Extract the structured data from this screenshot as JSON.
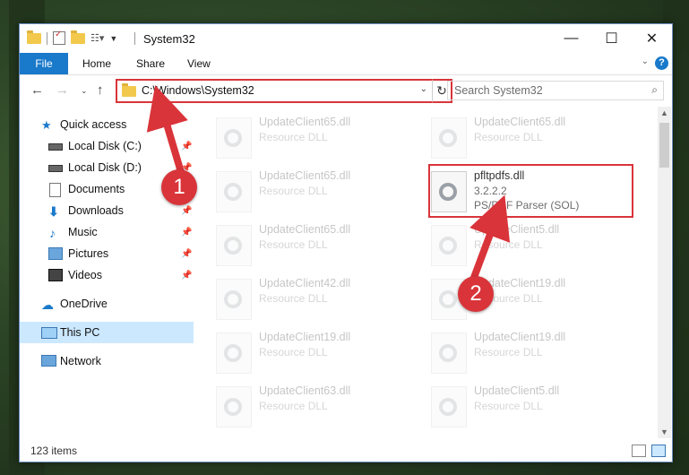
{
  "window": {
    "title": "System32"
  },
  "ribbon": {
    "tabs": [
      "File",
      "Home",
      "Share",
      "View"
    ],
    "help": "?"
  },
  "address": {
    "path": "C:\\Windows\\System32"
  },
  "search": {
    "placeholder": "Search System32"
  },
  "sidebar": {
    "items": [
      {
        "label": "Quick access",
        "icon": "star-icon"
      },
      {
        "label": "Local Disk (C:)",
        "icon": "drive-icon",
        "pinned": true
      },
      {
        "label": "Local Disk (D:)",
        "icon": "drive-icon",
        "pinned": true
      },
      {
        "label": "Documents",
        "icon": "documents-icon",
        "pinned": true
      },
      {
        "label": "Downloads",
        "icon": "download-icon",
        "pinned": true
      },
      {
        "label": "Music",
        "icon": "music-icon",
        "pinned": true
      },
      {
        "label": "Pictures",
        "icon": "pictures-icon",
        "pinned": true
      },
      {
        "label": "Videos",
        "icon": "videos-icon",
        "pinned": true
      },
      {
        "label": "OneDrive",
        "icon": "cloud-icon"
      },
      {
        "label": "This PC",
        "icon": "pc-icon",
        "selected": true
      },
      {
        "label": "Network",
        "icon": "network-icon"
      }
    ]
  },
  "files": [
    {
      "name": "UpdateClient65.dll",
      "type": "Resource DLL"
    },
    {
      "name": "UpdateClient65.dll",
      "type": "Resource DLL"
    },
    {
      "name": "UpdateClient65.dll",
      "type": "Resource DLL"
    },
    {
      "name": "pfltpdfs.dll",
      "version": "3.2.2.2",
      "description": "PS/PDF Parser (SOL)",
      "highlighted": true
    },
    {
      "name": "UpdateClient65.dll",
      "type": "Resource DLL"
    },
    {
      "name": "UpdateClient5.dll",
      "type": "Resource DLL"
    },
    {
      "name": "UpdateClient42.dll",
      "type": "Resource DLL"
    },
    {
      "name": "UpdateClient19.dll",
      "type": "Resource DLL"
    },
    {
      "name": "UpdateClient19.dll",
      "type": "Resource DLL"
    },
    {
      "name": "UpdateClient19.dll",
      "type": "Resource DLL"
    },
    {
      "name": "UpdateClient63.dll",
      "type": "Resource DLL"
    },
    {
      "name": "UpdateClient5.dll",
      "type": "Resource DLL"
    }
  ],
  "status": {
    "item_count": "123 items"
  },
  "annotations": {
    "step1": "1",
    "step2": "2",
    "color": "#d9343a"
  }
}
